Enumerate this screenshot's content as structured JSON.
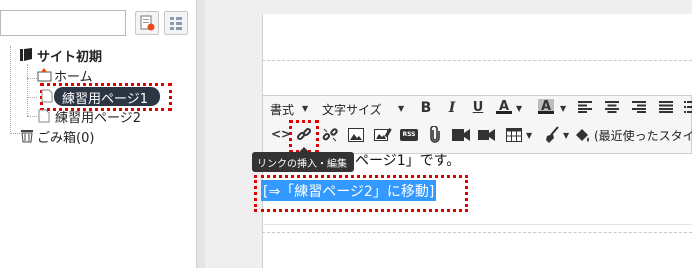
{
  "tree": {
    "root_label": "サイト初期",
    "items": [
      {
        "label": "ホーム"
      },
      {
        "label": "練習用ページ1",
        "selected": true
      },
      {
        "label": "練習用ページ2"
      }
    ],
    "trash_label": "ごみ箱(0)"
  },
  "toolbar": {
    "format_label": "書式",
    "font_size_label": "文字サイズ",
    "recent_style_label": "(最近使ったスタイ",
    "tooltip": "リンクの挿入・編集"
  },
  "content": {
    "paragraph_text": "ページ1」です。",
    "link_text": "[⇒「練習ページ2」に移動]"
  },
  "colors": {
    "highlight": "#e00000",
    "selection": "#3399ff",
    "selected_node": "#2b3544"
  }
}
